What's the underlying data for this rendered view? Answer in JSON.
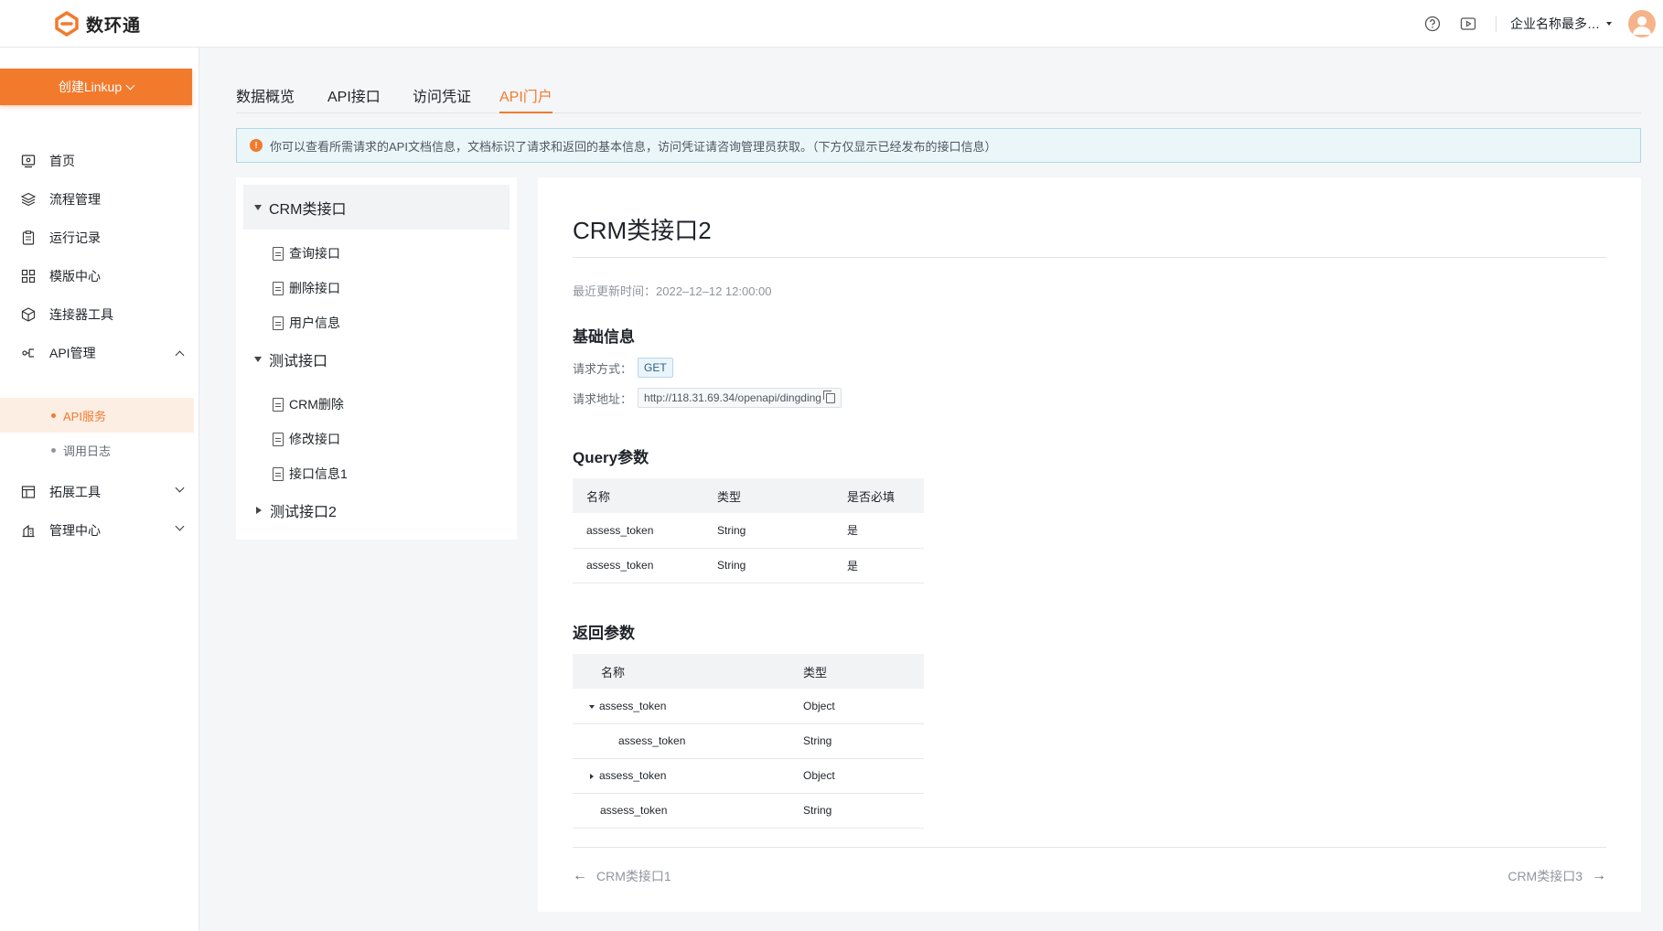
{
  "header": {
    "logo_text": "数环通",
    "company": "企业名称最多…",
    "colors": {
      "accent": "#f27a2d"
    }
  },
  "sidebar": {
    "create_button": "创建Linkup",
    "items": [
      {
        "label": "首页",
        "icon": "monitor-icon"
      },
      {
        "label": "流程管理",
        "icon": "layers-icon"
      },
      {
        "label": "运行记录",
        "icon": "clipboard-icon"
      },
      {
        "label": "模版中心",
        "icon": "grid-icon"
      },
      {
        "label": "连接器工具",
        "icon": "cube-icon"
      },
      {
        "label": "API管理",
        "icon": "api-icon"
      },
      {
        "label": "拓展工具",
        "icon": "window-icon"
      },
      {
        "label": "管理中心",
        "icon": "building-icon"
      }
    ],
    "sub_items": [
      {
        "label": "API服务",
        "active": true
      },
      {
        "label": "调用日志",
        "active": false
      }
    ]
  },
  "tabs": [
    {
      "label": "数据概览"
    },
    {
      "label": "API接口"
    },
    {
      "label": "访问凭证"
    },
    {
      "label": "API门户",
      "active": true
    }
  ],
  "alert": {
    "text": "你可以查看所需请求的API文档信息，文档标识了请求和返回的基本信息，访问凭证请咨询管理员获取。（下方仅显示已经发布的接口信息）"
  },
  "tree": {
    "groups": [
      {
        "label": "CRM类接口",
        "expanded": true,
        "selected": true,
        "children": [
          "查询接口",
          "删除接口",
          "用户信息"
        ]
      },
      {
        "label": "测试接口",
        "expanded": true,
        "children": [
          "CRM删除",
          "修改接口",
          "接口信息1"
        ]
      },
      {
        "label": "测试接口2",
        "expanded": false,
        "children": []
      }
    ]
  },
  "doc": {
    "title": "CRM类接口2",
    "updated": "最近更新时间：2022–12–12 12:00:00",
    "basic_title": "基础信息",
    "method_label": "请求方式：",
    "method": "GET",
    "url_label": "请求地址：",
    "url": "http://118.31.69.34/openapi/dingding",
    "query_title": "Query参数",
    "query_headers": [
      "名称",
      "类型",
      "是否必填"
    ],
    "query_rows": [
      [
        "assess_token",
        "String",
        "是"
      ],
      [
        "assess_token",
        "String",
        "是"
      ]
    ],
    "return_title": "返回参数",
    "return_headers": [
      "名称",
      "类型"
    ],
    "return_rows": [
      [
        "assess_token",
        "Object"
      ],
      [
        "assess_token",
        "String"
      ],
      [
        "assess_token",
        "Object"
      ],
      [
        "assess_token",
        "String"
      ]
    ],
    "prev": "CRM类接口1",
    "next": "CRM类接口3"
  }
}
